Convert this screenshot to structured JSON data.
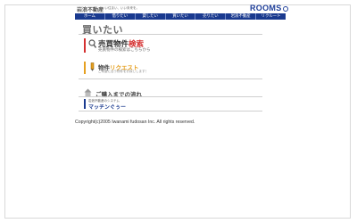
{
  "header": {
    "site_title": "岩浪不動産",
    "tagline": "いい住まい、いい未来を。",
    "logo_text": "ROOMS"
  },
  "nav": {
    "items": [
      {
        "label": "ホーム"
      },
      {
        "label": "借りたい"
      },
      {
        "label": "貸したい"
      },
      {
        "label": "買いたい"
      },
      {
        "label": "売りたい"
      },
      {
        "label": "岩浪不動産"
      },
      {
        "label": "リクルート"
      }
    ]
  },
  "page": {
    "heading": "買いたい"
  },
  "blocks": {
    "sale_search": {
      "title_prefix": "売買物件",
      "title_highlight": "検索",
      "subtitle": "売買物件の検索はこちらから"
    },
    "request": {
      "title_prefix": "物件",
      "title_highlight": "リクエスト",
      "subtitle": "ご希望に合う物件をお探しします！"
    },
    "flow": {
      "title": "ご購入までの流れ"
    },
    "matching": {
      "subtitle": "岩浪不動産のシステム",
      "title": "マッチンぐぅー"
    }
  },
  "footer": {
    "copyright": "Copyright(c)2005 Iwanami fudosan Inc. All rights reserved."
  },
  "colors": {
    "nav_bg": "#1a3a8f",
    "accent_red": "#d43030",
    "accent_orange": "#e6a020",
    "accent_blue": "#1a3a8f"
  }
}
